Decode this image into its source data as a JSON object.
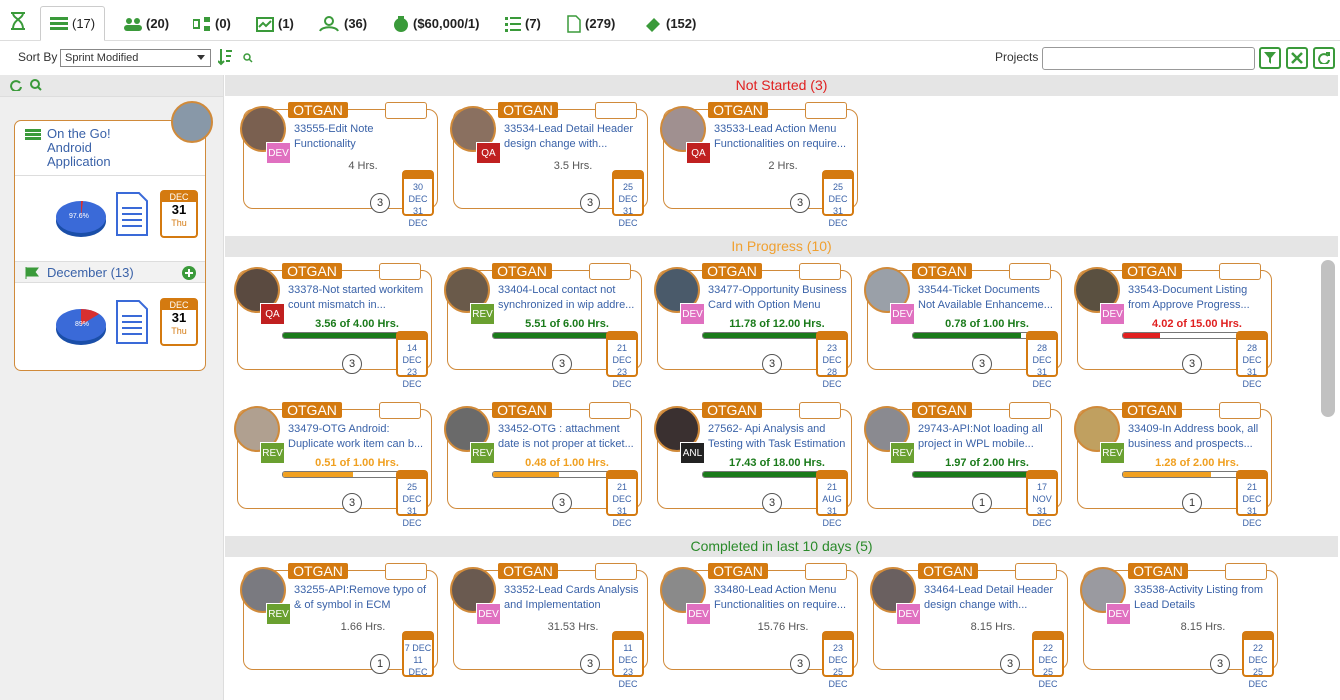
{
  "tabs": [
    {
      "label": "(17)",
      "icon": "list-icon"
    },
    {
      "label": "(20)",
      "icon": "users-icon"
    },
    {
      "label": "(0)",
      "icon": "flow-icon"
    },
    {
      "label": "(1)",
      "icon": "chart-icon"
    },
    {
      "label": "(36)",
      "icon": "team-icon"
    },
    {
      "label": "($60,000/1)",
      "icon": "money-bag-icon"
    },
    {
      "label": "(7)",
      "icon": "checklist-icon"
    },
    {
      "label": "(279)",
      "icon": "document-icon"
    },
    {
      "label": "(152)",
      "icon": "ticket-icon"
    }
  ],
  "toolbar": {
    "sort_label": "Sort By",
    "sort_value": "Sprint Modified",
    "projects_label": "Projects",
    "projects_value": ""
  },
  "project": {
    "title": "On the Go! Android Application",
    "pie1": "97.6%",
    "pie2": "89%",
    "cal_month": "DEC",
    "cal_day": "31",
    "cal_wd": "Thu",
    "sprint": "December (13)"
  },
  "sections": [
    {
      "label": "Not Started (3)",
      "color": "#e02020"
    },
    {
      "label": "In Progress (10)",
      "color": "#f0a030"
    },
    {
      "label": "Completed in last 10 days (5)",
      "color": "#2a8a2a"
    }
  ],
  "cards": [
    {
      "org": "OTGAN",
      "title": "33555-Edit Note Functionality",
      "role": "DEV",
      "hrs": "4 Hrs.",
      "count": "3",
      "d1": "30 DEC",
      "d2": "31 DEC"
    },
    {
      "org": "OTGAN",
      "title": "33534-Lead Detail Header design change with...",
      "role": "QA",
      "hrs": "3.5 Hrs.",
      "count": "3",
      "d1": "25 DEC",
      "d2": "31 DEC"
    },
    {
      "org": "OTGAN",
      "title": "33533-Lead Action Menu Functionalities on require...",
      "role": "QA",
      "hrs": "2 Hrs.",
      "count": "3",
      "d1": "25 DEC",
      "d2": "31 DEC"
    },
    {
      "org": "OTGAN",
      "title": "33378-Not started workitem count mismatch in...",
      "role": "QA",
      "hrs": "3.56 of 4.00 Hrs.",
      "count": "3",
      "d1": "14 DEC",
      "d2": "23 DEC",
      "pct": 0.89
    },
    {
      "org": "OTGAN",
      "title": "33404-Local contact not synchronized in wip addre...",
      "role": "REV",
      "hrs": "5.51 of 6.00 Hrs.",
      "count": "3",
      "d1": "21 DEC",
      "d2": "23 DEC",
      "pct": 0.92
    },
    {
      "org": "OTGAN",
      "title": "33477-Opportunity Business Card with Option Menu",
      "role": "DEV",
      "hrs": "11.78 of 12.00 Hrs.",
      "count": "3",
      "d1": "23 DEC",
      "d2": "28 DEC",
      "pct": 0.98
    },
    {
      "org": "OTGAN",
      "title": "33544-Ticket Documents Not Available Enhanceme...",
      "role": "DEV",
      "hrs": "0.78 of 1.00 Hrs.",
      "count": "3",
      "d1": "28 DEC",
      "d2": "31 DEC",
      "pct": 0.78
    },
    {
      "org": "OTGAN",
      "title": "33543-Document Listing from Approve Progress...",
      "role": "DEV",
      "hrs": "4.02 of 15.00 Hrs.",
      "count": "3",
      "d1": "28 DEC",
      "d2": "31 DEC",
      "pct": 0.27
    },
    {
      "org": "OTGAN",
      "title": "33479-OTG Android: Duplicate work item can b...",
      "role": "REV",
      "hrs": "0.51 of 1.00 Hrs.",
      "count": "3",
      "d1": "25 DEC",
      "d2": "31 DEC",
      "pct": 0.51
    },
    {
      "org": "OTGAN",
      "title": "33452-OTG : attachment date is not proper at ticket...",
      "role": "REV",
      "hrs": "0.48 of 1.00 Hrs.",
      "count": "3",
      "d1": "21 DEC",
      "d2": "31 DEC",
      "pct": 0.48
    },
    {
      "org": "OTGAN",
      "title": "27562- Api Analysis and Testing with Task Estimation",
      "role": "ANL",
      "hrs": "17.43 of 18.00 Hrs.",
      "count": "3",
      "d1": "21 AUG",
      "d2": "31 DEC",
      "pct": 0.97
    },
    {
      "org": "OTGAN",
      "title": "29743-API:Not loading all project in WPL mobile...",
      "role": "REV",
      "hrs": "1.97 of 2.00 Hrs.",
      "count": "1",
      "d1": "17 NOV",
      "d2": "31 DEC",
      "pct": 0.98
    },
    {
      "org": "OTGAN",
      "title": "33409-In Address book, all business and prospects...",
      "role": "REV",
      "hrs": "1.28 of 2.00 Hrs.",
      "count": "1",
      "d1": "21 DEC",
      "d2": "31 DEC",
      "pct": 0.64
    },
    {
      "org": "OTGAN",
      "title": "33255-API:Remove typo of & of symbol in ECM",
      "role": "REV",
      "hrs": "1.66 Hrs.",
      "count": "1",
      "d1": "7 DEC",
      "d2": "11 DEC"
    },
    {
      "org": "OTGAN",
      "title": "33352-Lead Cards Analysis and Implementation",
      "role": "DEV",
      "hrs": "31.53 Hrs.",
      "count": "3",
      "d1": "11 DEC",
      "d2": "23 DEC"
    },
    {
      "org": "OTGAN",
      "title": "33480-Lead Action Menu Functionalities on require...",
      "role": "DEV",
      "hrs": "15.76 Hrs.",
      "count": "3",
      "d1": "23 DEC",
      "d2": "25 DEC"
    },
    {
      "org": "OTGAN",
      "title": "33464-Lead Detail Header design change with...",
      "role": "DEV",
      "hrs": "8.15 Hrs.",
      "count": "3",
      "d1": "22 DEC",
      "d2": "25 DEC"
    },
    {
      "org": "OTGAN",
      "title": "33538-Activity Listing from Lead Details",
      "role": "DEV",
      "hrs": "8.15 Hrs.",
      "count": "3",
      "d1": "22 DEC",
      "d2": "25 DEC"
    }
  ]
}
